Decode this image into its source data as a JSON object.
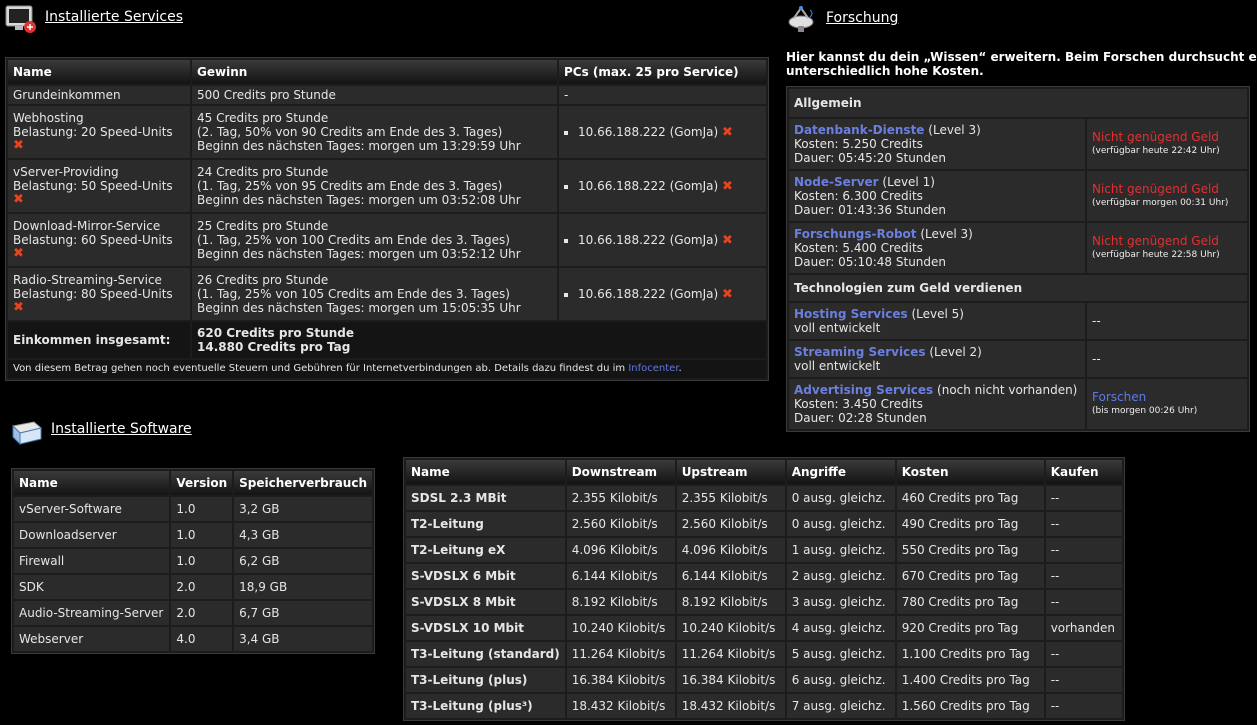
{
  "services": {
    "title": "Installierte Services",
    "headers": [
      "Name",
      "Gewinn",
      "PCs (max. 25 pro Service)"
    ],
    "grund": {
      "name": "Grundeinkommen",
      "gewinn": "500 Credits pro Stunde",
      "pcs": "-"
    },
    "rows": [
      {
        "name": "Webhosting",
        "load": "Belastung: 20 Speed-Units",
        "g1": "45 Credits pro Stunde",
        "g2": "(2. Tag, 50% von 90 Credits am Ende des 3. Tages)",
        "g3": "Beginn des nächsten Tages: morgen um 13:29:59 Uhr",
        "pc": "10.66.188.222 (GomJa)"
      },
      {
        "name": "vServer-Providing",
        "load": "Belastung: 50 Speed-Units",
        "g1": "24 Credits pro Stunde",
        "g2": "(1. Tag, 25% von 95 Credits am Ende des 3. Tages)",
        "g3": "Beginn des nächsten Tages: morgen um 03:52:08 Uhr",
        "pc": "10.66.188.222 (GomJa)"
      },
      {
        "name": "Download-Mirror-Service",
        "load": "Belastung: 60 Speed-Units",
        "g1": "25 Credits pro Stunde",
        "g2": "(1. Tag, 25% von 100 Credits am Ende des 3. Tages)",
        "g3": "Beginn des nächsten Tages: morgen um 03:52:12 Uhr",
        "pc": "10.66.188.222 (GomJa)"
      },
      {
        "name": "Radio-Streaming-Service",
        "load": "Belastung: 80 Speed-Units",
        "g1": "26 Credits pro Stunde",
        "g2": "(1. Tag, 25% von 105 Credits am Ende des 3. Tages)",
        "g3": "Beginn des nächsten Tages: morgen um 15:05:35 Uhr",
        "pc": "10.66.188.222 (GomJa)"
      }
    ],
    "total_label": "Einkommen insgesamt:",
    "total_hour": "620 Credits pro Stunde",
    "total_day": "14.880 Credits pro Tag",
    "footnote": "Von diesem Betrag gehen noch eventuelle Steuern und Gebühren für Internetverbindungen ab. Details dazu findest du im ",
    "footnote_link": "Infocenter",
    "footnote_end": "."
  },
  "software": {
    "title": "Installierte Software",
    "headers": [
      "Name",
      "Version",
      "Speicherverbrauch"
    ],
    "rows": [
      [
        "vServer-Software",
        "1.0",
        "3,2 GB"
      ],
      [
        "Downloadserver",
        "1.0",
        "4,3 GB"
      ],
      [
        "Firewall",
        "1.0",
        "6,2 GB"
      ],
      [
        "SDK",
        "2.0",
        "18,9 GB"
      ],
      [
        "Audio-Streaming-Server",
        "2.0",
        "6,7 GB"
      ],
      [
        "Webserver",
        "4.0",
        "3,4 GB"
      ]
    ]
  },
  "connections": {
    "headers": [
      "Name",
      "Downstream",
      "Upstream",
      "Angriffe",
      "Kosten",
      "Kaufen"
    ],
    "rows": [
      [
        "SDSL 2.3 MBit",
        "2.355 Kilobit/s",
        "2.355 Kilobit/s",
        "0 ausg. gleichz.",
        "460 Credits pro Tag",
        "--"
      ],
      [
        "T2-Leitung",
        "2.560 Kilobit/s",
        "2.560 Kilobit/s",
        "0 ausg. gleichz.",
        "490 Credits pro Tag",
        "--"
      ],
      [
        "T2-Leitung eX",
        "4.096 Kilobit/s",
        "4.096 Kilobit/s",
        "1 ausg. gleichz.",
        "550 Credits pro Tag",
        "--"
      ],
      [
        "S-VDSLX 6 Mbit",
        "6.144 Kilobit/s",
        "6.144 Kilobit/s",
        "2 ausg. gleichz.",
        "670 Credits pro Tag",
        "--"
      ],
      [
        "S-VDSLX 8 Mbit",
        "8.192 Kilobit/s",
        "8.192 Kilobit/s",
        "3 ausg. gleichz.",
        "780 Credits pro Tag",
        "--"
      ],
      [
        "S-VDSLX 10 Mbit",
        "10.240 Kilobit/s",
        "10.240 Kilobit/s",
        "4 ausg. gleichz.",
        "920 Credits pro Tag",
        "vorhanden"
      ],
      [
        "T3-Leitung (standard)",
        "11.264 Kilobit/s",
        "11.264 Kilobit/s",
        "5 ausg. gleichz.",
        "1.100 Credits pro Tag",
        "--"
      ],
      [
        "T3-Leitung (plus)",
        "16.384 Kilobit/s",
        "16.384 Kilobit/s",
        "6 ausg. gleichz.",
        "1.400 Credits pro Tag",
        "--"
      ],
      [
        "T3-Leitung (plus³)",
        "18.432 Kilobit/s",
        "18.432 Kilobit/s",
        "7 ausg. gleichz.",
        "1.560 Credits pro Tag",
        "--"
      ]
    ]
  },
  "research": {
    "title": "Forschung",
    "intro1": "Hier kannst du dein „Wissen“ erweitern. Beim Forschen durchsucht ein",
    "intro2": "unterschiedlich hohe Kosten.",
    "cat1": "Allgemein",
    "cat2": "Technologien zum Geld verdienen",
    "general": [
      {
        "name": "Datenbank-Dienste",
        "level": "(Level 3)",
        "cost": "Kosten: 5.250 Credits",
        "dur": "Dauer: 05:45:20 Stunden",
        "status": "Nicht genügend Geld",
        "avail": "(verfügbar heute 22:42 Uhr)"
      },
      {
        "name": "Node-Server",
        "level": "(Level 1)",
        "cost": "Kosten: 6.300 Credits",
        "dur": "Dauer: 01:43:36 Stunden",
        "status": "Nicht genügend Geld",
        "avail": "(verfügbar morgen 00:31 Uhr)"
      },
      {
        "name": "Forschungs-Robot",
        "level": "(Level 3)",
        "cost": "Kosten: 5.400 Credits",
        "dur": "Dauer: 05:10:48 Stunden",
        "status": "Nicht genügend Geld",
        "avail": "(verfügbar heute 22:58 Uhr)"
      }
    ],
    "tech": [
      {
        "name": "Hosting Services",
        "level": "(Level 5)",
        "sub": "voll entwickelt",
        "status": "--"
      },
      {
        "name": "Streaming Services",
        "level": "(Level 2)",
        "sub": "voll entwickelt",
        "status": "--"
      }
    ],
    "adv": {
      "name": "Advertising Services",
      "level": "(noch nicht vorhanden)",
      "cost": "Kosten: 3.450 Credits",
      "dur": "Dauer: 02:28 Stunden",
      "action": "Forschen",
      "avail": "(bis morgen 00:26 Uhr)"
    }
  }
}
